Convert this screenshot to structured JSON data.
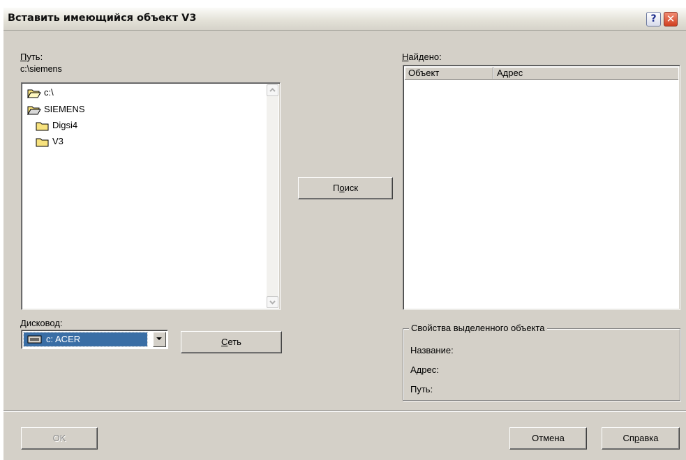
{
  "window": {
    "title": "Вставить имеющийся объект V3",
    "help_label": "?",
    "close_label": "✕"
  },
  "path": {
    "label": "Путь:",
    "value": "c:\\siemens"
  },
  "tree": {
    "items": [
      {
        "label": "c:\\",
        "icon": "open-folder-icon"
      },
      {
        "label": "SIEMENS",
        "icon": "open-folder-icon"
      },
      {
        "label": "Digsi4",
        "icon": "closed-folder-icon"
      },
      {
        "label": "V3",
        "icon": "closed-folder-icon"
      }
    ]
  },
  "drive": {
    "label": "Дисковод:",
    "value": "c: ACER",
    "icon": "drive-icon"
  },
  "buttons": {
    "search": "Поиск",
    "network": "Сеть",
    "ok": "OK",
    "cancel": "Отмена",
    "help": "Справка"
  },
  "found": {
    "label": "Найдено:",
    "columns": [
      "Объект",
      "Адрес"
    ],
    "rows": []
  },
  "properties": {
    "title": "Свойства выделенного объекта",
    "name_label": "Название:",
    "address_label": "Адрес:",
    "path_label": "Путь:"
  },
  "colors": {
    "selection": "#3a6ea5",
    "dialog_bg": "#d4d0c8",
    "folder": "#f7e27e"
  }
}
